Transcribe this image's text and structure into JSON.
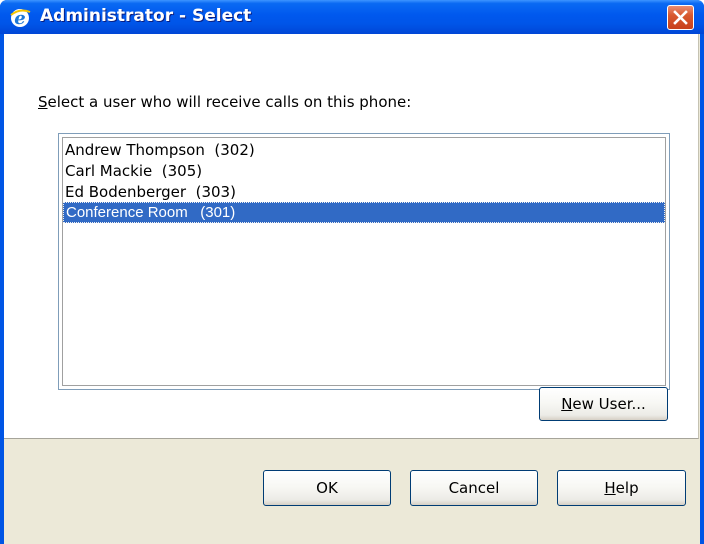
{
  "window": {
    "title": "Administrator - Select"
  },
  "prompt": {
    "accel": "S",
    "rest": "elect a user who will receive calls on this phone:"
  },
  "users": [
    {
      "label": "Andrew Thompson  (302)",
      "selected": false
    },
    {
      "label": "Carl Mackie  (305)",
      "selected": false
    },
    {
      "label": "Ed Bodenberger  (303)",
      "selected": false
    },
    {
      "label": "Conference Room   (301)",
      "selected": true
    }
  ],
  "buttons": {
    "new_user": {
      "accel": "N",
      "rest": "ew User..."
    },
    "ok": "OK",
    "cancel": "Cancel",
    "help": {
      "accel": "H",
      "rest": "elp"
    }
  },
  "colors": {
    "titlebar": "#0055e5",
    "selection": "#316ac5",
    "dialog_face": "#ece9d8",
    "close_button": "#c8401b"
  },
  "icons": {
    "title": "internet-explorer-icon",
    "close": "close-x-icon"
  }
}
